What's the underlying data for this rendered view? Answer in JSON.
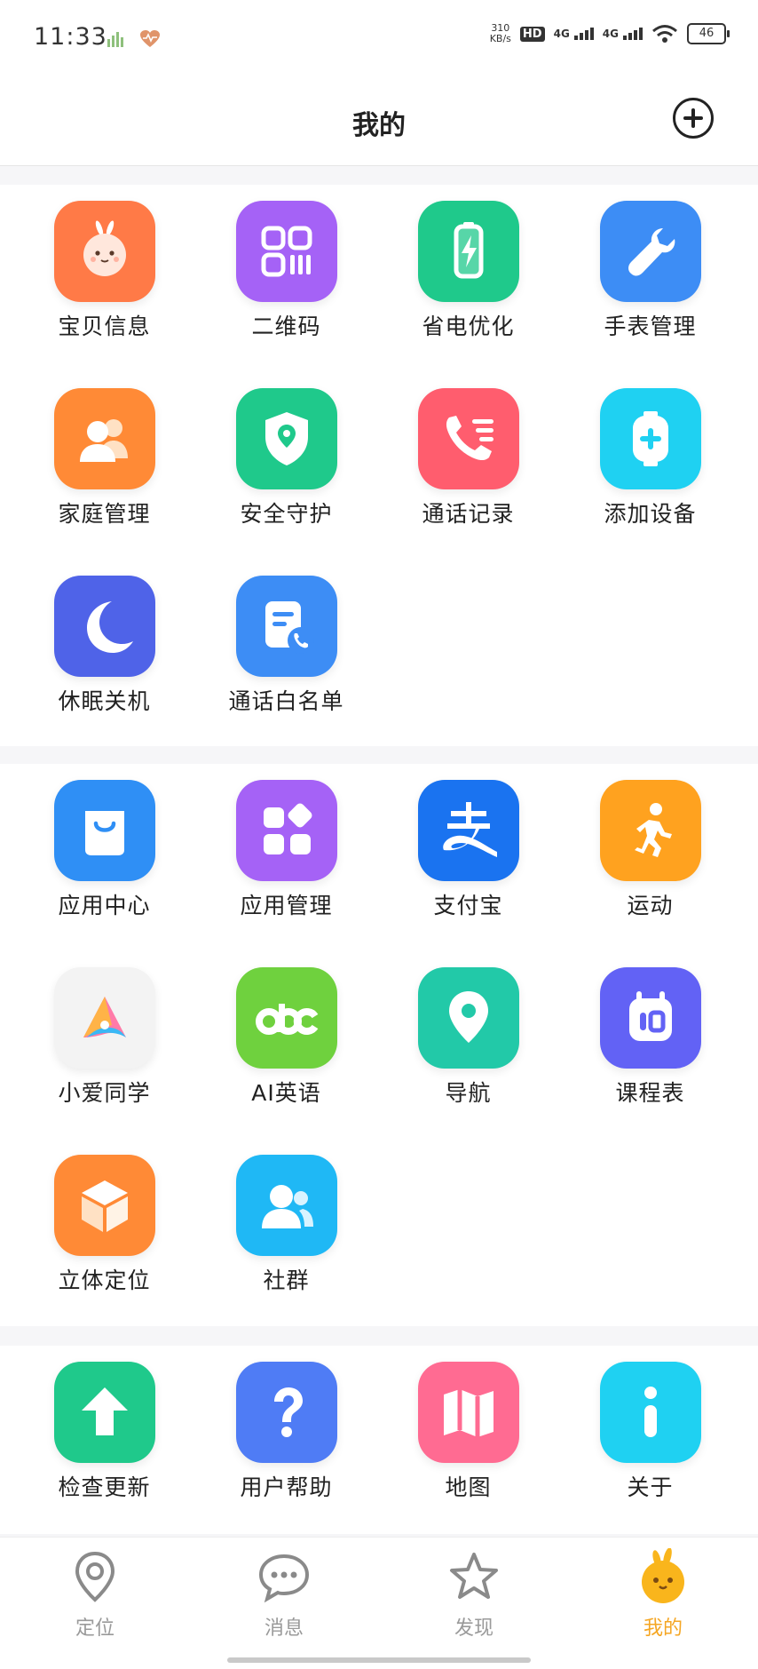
{
  "status_bar": {
    "time": "11:33",
    "speed_value": "310",
    "speed_unit": "KB/s",
    "hd_label": "HD",
    "net1": "4G",
    "net2": "4G",
    "battery": "46"
  },
  "header": {
    "title": "我的",
    "add_icon": "plus-circle-icon"
  },
  "sections": [
    {
      "items": [
        {
          "label": "宝贝信息",
          "icon": "baby-icon",
          "color": "#ff7a47"
        },
        {
          "label": "二维码",
          "icon": "qr-code-icon",
          "color": "#a562f6"
        },
        {
          "label": "省电优化",
          "icon": "battery-icon",
          "color": "#1fc98b"
        },
        {
          "label": "手表管理",
          "icon": "wrench-icon",
          "color": "#3d8df5"
        },
        {
          "label": "家庭管理",
          "icon": "family-icon",
          "color": "#ff8a36"
        },
        {
          "label": "安全守护",
          "icon": "shield-icon",
          "color": "#1fc98b"
        },
        {
          "label": "通话记录",
          "icon": "call-log-icon",
          "color": "#ff5d6e"
        },
        {
          "label": "添加设备",
          "icon": "add-device-icon",
          "color": "#1fd1f2"
        },
        {
          "label": "休眠关机",
          "icon": "moon-icon",
          "color": "#4f63e8"
        },
        {
          "label": "通话白名单",
          "icon": "whitelist-icon",
          "color": "#3d8df5"
        }
      ]
    },
    {
      "items": [
        {
          "label": "应用中心",
          "icon": "shopping-bag-icon",
          "color": "#2f8ff5"
        },
        {
          "label": "应用管理",
          "icon": "app-grid-icon",
          "color": "#a562f6"
        },
        {
          "label": "支付宝",
          "icon": "alipay-icon",
          "color": "#1a73f0"
        },
        {
          "label": "运动",
          "icon": "running-icon",
          "color": "#ffa21f"
        },
        {
          "label": "小爱同学",
          "icon": "xiaoai-icon",
          "color": "#f3f3f3"
        },
        {
          "label": "AI英语",
          "icon": "abc-icon",
          "color": "#6fd13e"
        },
        {
          "label": "导航",
          "icon": "location-pin-icon",
          "color": "#22c9a8"
        },
        {
          "label": "课程表",
          "icon": "calendar-icon",
          "color": "#6262f5"
        },
        {
          "label": "立体定位",
          "icon": "cube-icon",
          "color": "#ff8a36"
        },
        {
          "label": "社群",
          "icon": "community-icon",
          "color": "#1fb8f5"
        }
      ]
    },
    {
      "items": [
        {
          "label": "检查更新",
          "icon": "arrow-up-icon",
          "color": "#1fc98b"
        },
        {
          "label": "用户帮助",
          "icon": "question-icon",
          "color": "#4f7cf5"
        },
        {
          "label": "地图",
          "icon": "map-icon",
          "color": "#ff6b92"
        },
        {
          "label": "关于",
          "icon": "info-icon",
          "color": "#1fd1f2"
        }
      ]
    }
  ],
  "bottom_nav": [
    {
      "label": "定位",
      "icon": "location-icon",
      "active": false
    },
    {
      "label": "消息",
      "icon": "message-icon",
      "active": false
    },
    {
      "label": "发现",
      "icon": "star-icon",
      "active": false
    },
    {
      "label": "我的",
      "icon": "mascot-icon",
      "active": true
    }
  ],
  "colors": {
    "active_nav": "#f5a623",
    "inactive_nav": "#9a9a9a"
  }
}
